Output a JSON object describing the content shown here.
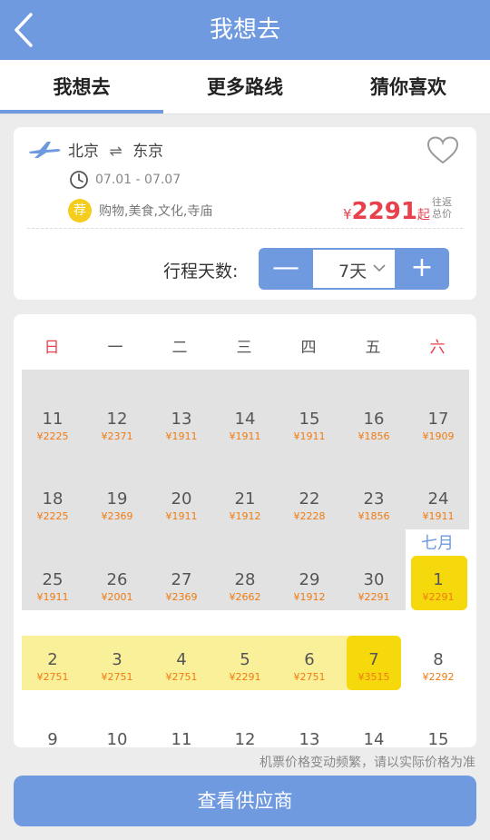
{
  "header": {
    "title": "我想去",
    "back_icon": "chevron-left-icon"
  },
  "tabs": [
    {
      "label": "我想去"
    },
    {
      "label": "更多路线"
    },
    {
      "label": "猜你喜欢"
    }
  ],
  "trip": {
    "plane_icon": "airplane-icon",
    "from": "北京",
    "swap": "⇌",
    "to": "东京",
    "favorite_icon": "heart-icon",
    "clock_icon": "clock-icon",
    "dates": "07.01 - 07.07",
    "rec_badge": "荐",
    "tags": "购物,美食,文化,寺庙",
    "price_currency": "¥",
    "price_value": "2291",
    "price_suffix": "起",
    "price_note_1": "往返",
    "price_note_2": "总价"
  },
  "duration": {
    "label": "行程天数:",
    "minus": "—",
    "value": "7天",
    "plus": "+"
  },
  "calendar": {
    "weekdays": [
      "日",
      "一",
      "二",
      "三",
      "四",
      "五",
      "六"
    ],
    "month_label": "七月",
    "weeks": [
      [
        {
          "d": "11",
          "p": "¥2225"
        },
        {
          "d": "12",
          "p": "¥2371"
        },
        {
          "d": "13",
          "p": "¥1911"
        },
        {
          "d": "14",
          "p": "¥1911"
        },
        {
          "d": "15",
          "p": "¥1911"
        },
        {
          "d": "16",
          "p": "¥1856"
        },
        {
          "d": "17",
          "p": "¥1909"
        }
      ],
      [
        {
          "d": "18",
          "p": "¥2225"
        },
        {
          "d": "19",
          "p": "¥2369"
        },
        {
          "d": "20",
          "p": "¥1911"
        },
        {
          "d": "21",
          "p": "¥1912"
        },
        {
          "d": "22",
          "p": "¥2228"
        },
        {
          "d": "23",
          "p": "¥1856"
        },
        {
          "d": "24",
          "p": "¥1911"
        }
      ],
      [
        {
          "d": "25",
          "p": "¥1911"
        },
        {
          "d": "26",
          "p": "¥2001"
        },
        {
          "d": "27",
          "p": "¥2369"
        },
        {
          "d": "28",
          "p": "¥2662"
        },
        {
          "d": "29",
          "p": "¥1912"
        },
        {
          "d": "30",
          "p": "¥2291"
        },
        {
          "d": "1",
          "p": "¥2291"
        }
      ],
      [
        {
          "d": "2",
          "p": "¥2751"
        },
        {
          "d": "3",
          "p": "¥2751"
        },
        {
          "d": "4",
          "p": "¥2751"
        },
        {
          "d": "5",
          "p": "¥2291"
        },
        {
          "d": "6",
          "p": "¥2751"
        },
        {
          "d": "7",
          "p": "¥3515"
        },
        {
          "d": "8",
          "p": "¥2292"
        }
      ],
      [
        {
          "d": "9",
          "p": ""
        },
        {
          "d": "10",
          "p": ""
        },
        {
          "d": "11",
          "p": ""
        },
        {
          "d": "12",
          "p": ""
        },
        {
          "d": "13",
          "p": ""
        },
        {
          "d": "14",
          "p": ""
        },
        {
          "d": "15",
          "p": ""
        }
      ]
    ]
  },
  "notice": "机票价格变动频繁，请以实际价格为准",
  "cta": "查看供应商",
  "colors": {
    "accent": "#6f9ae0",
    "price": "#e8414d",
    "day_price": "#f07b12",
    "selected": "#f5d90c",
    "range": "#fbf09a"
  }
}
